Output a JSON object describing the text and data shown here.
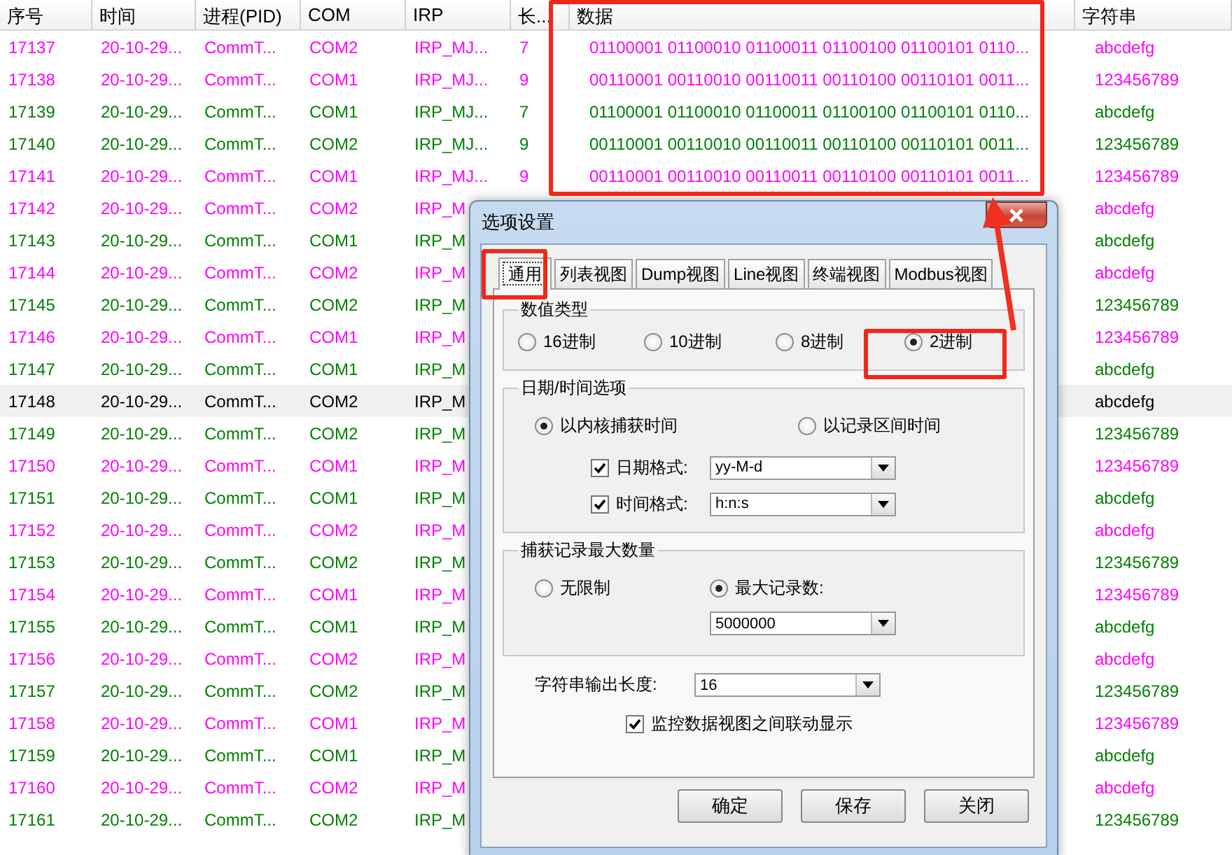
{
  "table": {
    "columns": [
      "序号",
      "时间",
      "进程(PID)",
      "COM",
      "IRP",
      "长...",
      "数据",
      "字符串"
    ],
    "rows": [
      {
        "seq": "17137",
        "time": "20-10-29...",
        "process": "CommT...",
        "com": "COM2",
        "irp": "IRP_MJ...",
        "length": "7",
        "data": "01100001 01100010 01100011 01100100 01100101 0110...",
        "string": "abcdefg",
        "color": "#ff00ff",
        "selected": false
      },
      {
        "seq": "17138",
        "time": "20-10-29...",
        "process": "CommT...",
        "com": "COM1",
        "irp": "IRP_MJ...",
        "length": "9",
        "data": "00110001 00110010 00110011 00110100 00110101 0011...",
        "string": "123456789",
        "color": "#ff00ff",
        "selected": false
      },
      {
        "seq": "17139",
        "time": "20-10-29...",
        "process": "CommT...",
        "com": "COM1",
        "irp": "IRP_MJ...",
        "length": "7",
        "data": "01100001 01100010 01100011 01100100 01100101 0110...",
        "string": "abcdefg",
        "color": "#008000",
        "selected": false
      },
      {
        "seq": "17140",
        "time": "20-10-29...",
        "process": "CommT...",
        "com": "COM2",
        "irp": "IRP_MJ...",
        "length": "9",
        "data": "00110001 00110010 00110011 00110100 00110101 0011...",
        "string": "123456789",
        "color": "#008000",
        "selected": false
      },
      {
        "seq": "17141",
        "time": "20-10-29...",
        "process": "CommT...",
        "com": "COM1",
        "irp": "IRP_MJ...",
        "length": "9",
        "data": "00110001 00110010 00110011 00110100 00110101 0011...",
        "string": "123456789",
        "color": "#ff00ff",
        "selected": false
      },
      {
        "seq": "17142",
        "time": "20-10-29...",
        "process": "CommT...",
        "com": "COM2",
        "irp": "IRP_M",
        "string": "abcdefg",
        "color": "#ff00ff",
        "selected": false
      },
      {
        "seq": "17143",
        "time": "20-10-29...",
        "process": "CommT...",
        "com": "COM1",
        "irp": "IRP_M",
        "string": "abcdefg",
        "color": "#008000",
        "selected": false
      },
      {
        "seq": "17144",
        "time": "20-10-29...",
        "process": "CommT...",
        "com": "COM2",
        "irp": "IRP_M",
        "string": "abcdefg",
        "color": "#ff00ff",
        "selected": false
      },
      {
        "seq": "17145",
        "time": "20-10-29...",
        "process": "CommT...",
        "com": "COM2",
        "irp": "IRP_M",
        "string": "123456789",
        "color": "#008000",
        "selected": false
      },
      {
        "seq": "17146",
        "time": "20-10-29...",
        "process": "CommT...",
        "com": "COM1",
        "irp": "IRP_M",
        "string": "123456789",
        "color": "#ff00ff",
        "selected": false
      },
      {
        "seq": "17147",
        "time": "20-10-29...",
        "process": "CommT...",
        "com": "COM1",
        "irp": "IRP_M",
        "string": "abcdefg",
        "color": "#008000",
        "selected": false
      },
      {
        "seq": "17148",
        "time": "20-10-29...",
        "process": "CommT...",
        "com": "COM2",
        "irp": "IRP_M",
        "string": "abcdefg",
        "selected": true
      },
      {
        "seq": "17149",
        "time": "20-10-29...",
        "process": "CommT...",
        "com": "COM2",
        "irp": "IRP_M",
        "string": "123456789",
        "color": "#008000",
        "selected": false
      },
      {
        "seq": "17150",
        "time": "20-10-29...",
        "process": "CommT...",
        "com": "COM1",
        "irp": "IRP_M",
        "string": "123456789",
        "color": "#ff00ff",
        "selected": false
      },
      {
        "seq": "17151",
        "time": "20-10-29...",
        "process": "CommT...",
        "com": "COM1",
        "irp": "IRP_M",
        "string": "abcdefg",
        "color": "#008000",
        "selected": false
      },
      {
        "seq": "17152",
        "time": "20-10-29...",
        "process": "CommT...",
        "com": "COM2",
        "irp": "IRP_M",
        "string": "abcdefg",
        "color": "#ff00ff",
        "selected": false
      },
      {
        "seq": "17153",
        "time": "20-10-29...",
        "process": "CommT...",
        "com": "COM2",
        "irp": "IRP_M",
        "string": "123456789",
        "color": "#008000",
        "selected": false
      },
      {
        "seq": "17154",
        "time": "20-10-29...",
        "process": "CommT...",
        "com": "COM1",
        "irp": "IRP_M",
        "string": "123456789",
        "color": "#ff00ff",
        "selected": false
      },
      {
        "seq": "17155",
        "time": "20-10-29...",
        "process": "CommT...",
        "com": "COM1",
        "irp": "IRP_M",
        "string": "abcdefg",
        "color": "#008000",
        "selected": false
      },
      {
        "seq": "17156",
        "time": "20-10-29...",
        "process": "CommT...",
        "com": "COM2",
        "irp": "IRP_M",
        "string": "abcdefg",
        "color": "#ff00ff",
        "selected": false
      },
      {
        "seq": "17157",
        "time": "20-10-29...",
        "process": "CommT...",
        "com": "COM2",
        "irp": "IRP_M",
        "string": "123456789",
        "color": "#008000",
        "selected": false
      },
      {
        "seq": "17158",
        "time": "20-10-29...",
        "process": "CommT...",
        "com": "COM1",
        "irp": "IRP_M",
        "string": "123456789",
        "color": "#ff00ff",
        "selected": false
      },
      {
        "seq": "17159",
        "time": "20-10-29...",
        "process": "CommT...",
        "com": "COM1",
        "irp": "IRP_M",
        "string": "abcdefg",
        "color": "#008000",
        "selected": false
      },
      {
        "seq": "17160",
        "time": "20-10-29...",
        "process": "CommT...",
        "com": "COM2",
        "irp": "IRP_M",
        "string": "abcdefg",
        "color": "#ff00ff",
        "selected": false
      },
      {
        "seq": "17161",
        "time": "20-10-29...",
        "process": "CommT...",
        "com": "COM2",
        "irp": "IRP_M",
        "string": "123456789",
        "color": "#008000",
        "selected": false
      }
    ]
  },
  "dialog": {
    "title": "选项设置",
    "tabs": [
      {
        "label": "通用",
        "selected": true
      },
      {
        "label": "列表视图",
        "selected": false
      },
      {
        "label": "Dump视图",
        "selected": false
      },
      {
        "label": "Line视图",
        "selected": false
      },
      {
        "label": "终端视图",
        "selected": false
      },
      {
        "label": "Modbus视图",
        "selected": false
      }
    ],
    "value_type": {
      "title": "数值类型",
      "options": [
        {
          "label": "16进制",
          "selected": false
        },
        {
          "label": "10进制",
          "selected": false
        },
        {
          "label": "8进制",
          "selected": false
        },
        {
          "label": "2进制",
          "selected": true
        }
      ]
    },
    "datetime": {
      "title": "日期/时间选项",
      "options": [
        {
          "label": "以内核捕获时间",
          "selected": true
        },
        {
          "label": "以记录区间时间",
          "selected": false
        }
      ],
      "formats": [
        {
          "label": "日期格式:",
          "checked": true,
          "value": "yy-M-d"
        },
        {
          "label": "时间格式:",
          "checked": true,
          "value": "h:n:s"
        }
      ]
    },
    "max_records": {
      "title": "捕获记录最大数量",
      "options": [
        {
          "label": "无限制",
          "selected": false
        },
        {
          "label": "最大记录数:",
          "selected": true
        }
      ],
      "value": "5000000"
    },
    "string_length": {
      "label": "字符串输出长度:",
      "value": "16"
    },
    "linked_display": {
      "label": "监控数据视图之间联动显示",
      "checked": true
    },
    "buttons": [
      "确定",
      "保存",
      "关闭"
    ]
  }
}
